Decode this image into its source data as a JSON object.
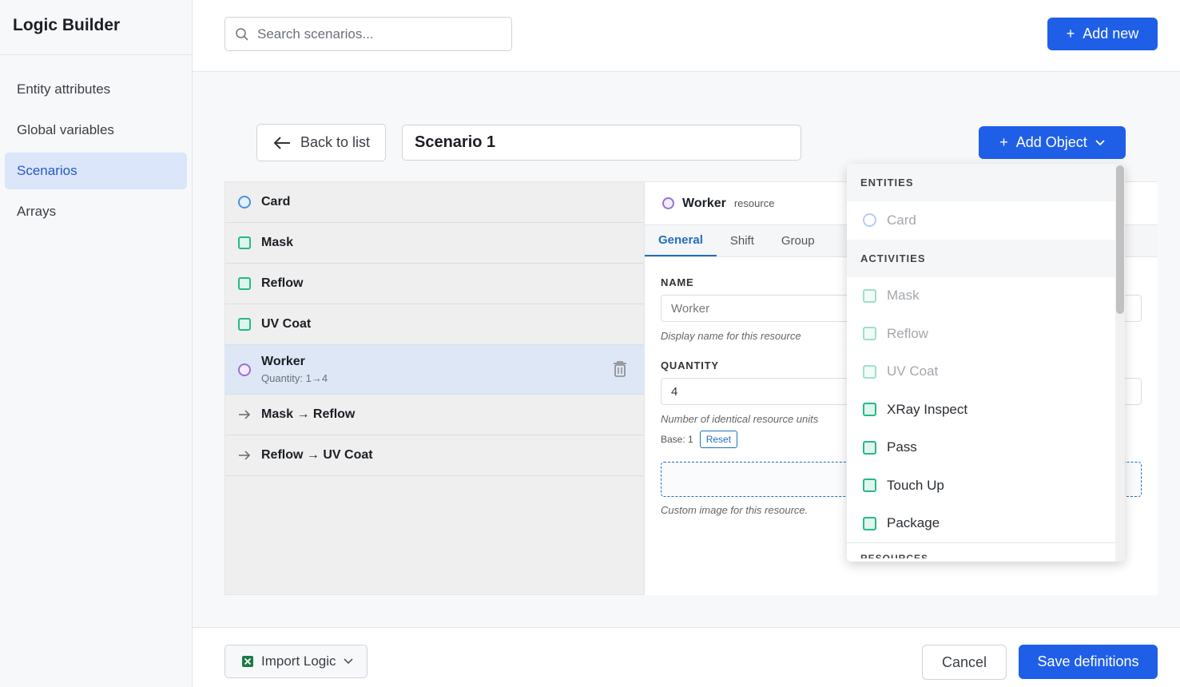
{
  "app": {
    "title": "Logic Builder"
  },
  "sidebar": {
    "items": [
      {
        "label": "Entity attributes"
      },
      {
        "label": "Global variables"
      },
      {
        "label": "Scenarios",
        "active": true
      },
      {
        "label": "Arrays"
      }
    ]
  },
  "topbar": {
    "search_placeholder": "Search scenarios...",
    "add_new_label": "Add new"
  },
  "editor": {
    "back_label": "Back to list",
    "scenario_name": "Scenario 1",
    "add_object_label": "Add Object"
  },
  "objects": [
    {
      "label": "Card",
      "kind": "entity",
      "icon": "circle-icon"
    },
    {
      "label": "Mask",
      "kind": "activity",
      "icon": "square-icon"
    },
    {
      "label": "Reflow",
      "kind": "activity",
      "icon": "square-icon"
    },
    {
      "label": "UV Coat",
      "kind": "activity",
      "icon": "square-icon"
    },
    {
      "label": "Worker",
      "kind": "resource",
      "icon": "circle-icon",
      "sub": "Quantity: 1→4",
      "selected": true
    },
    {
      "label": "Mask → Reflow",
      "kind": "connection",
      "icon": "arrow-right-icon"
    },
    {
      "label": "Reflow → UV Coat",
      "kind": "connection",
      "icon": "arrow-right-icon"
    }
  ],
  "detail": {
    "title": "Worker",
    "kind": "resource",
    "tabs": [
      "General",
      "Shift",
      "Group"
    ],
    "active_tab": "General",
    "name_label": "NAME",
    "name_value": "Worker",
    "name_hint": "Display name for this resource",
    "quantity_label": "QUANTITY",
    "quantity_value": "4",
    "quantity_hint": "Number of identical resource units",
    "base_label": "Base: 1",
    "reset_label": "Reset",
    "image_hint": "Custom image for this resource."
  },
  "dropdown": {
    "sections": [
      {
        "title": "ENTITIES",
        "items": [
          {
            "label": "Card",
            "disabled": true
          }
        ]
      },
      {
        "title": "ACTIVITIES",
        "items": [
          {
            "label": "Mask",
            "disabled": true
          },
          {
            "label": "Reflow",
            "disabled": true
          },
          {
            "label": "UV Coat",
            "disabled": true
          },
          {
            "label": "XRay Inspect",
            "disabled": false
          },
          {
            "label": "Pass",
            "disabled": false
          },
          {
            "label": "Touch Up",
            "disabled": false
          },
          {
            "label": "Package",
            "disabled": false
          }
        ]
      }
    ],
    "cut_section": "RESOURCES"
  },
  "footer": {
    "import_label": "Import Logic",
    "cancel_label": "Cancel",
    "save_label": "Save definitions"
  },
  "colors": {
    "primary": "#1f5fe8",
    "entity": "#4a90e2",
    "activity": "#29b887",
    "resource": "#9b6fd8",
    "selected_row": "#dde7f6"
  }
}
